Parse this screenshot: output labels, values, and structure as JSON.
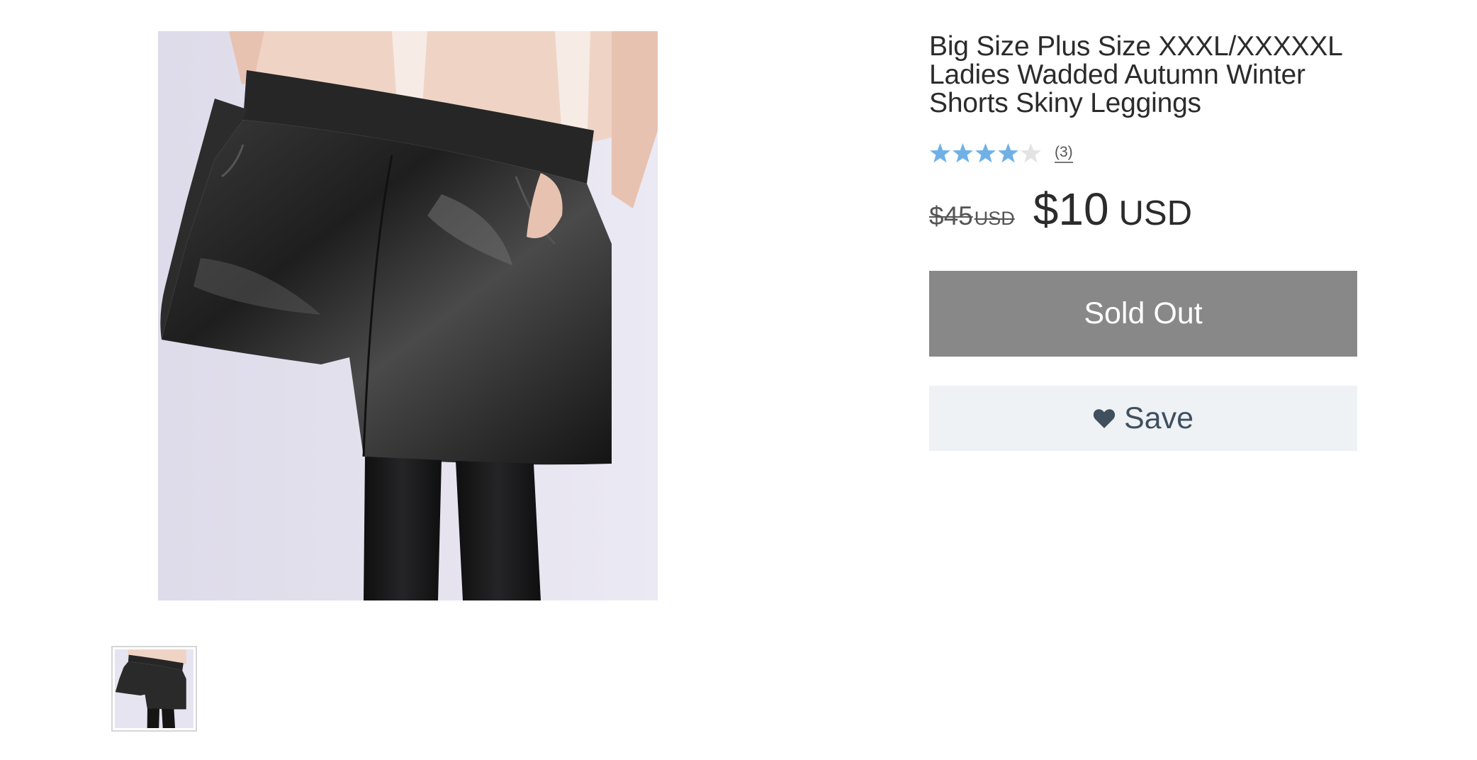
{
  "product": {
    "title": "Big Size Plus Size XXXL/XXXXXL Ladies Wadded Autumn Winter Shorts Skiny Leggings",
    "rating": {
      "value": 4,
      "max": 5,
      "review_count_label": "(3)"
    },
    "price": {
      "compare_at": "$45",
      "compare_at_currency": "USD",
      "current": "$10",
      "current_currency": "USD"
    },
    "buttons": {
      "sold_out_label": "Sold Out",
      "save_label": "Save"
    },
    "media": {
      "main_image_icon": "product-photo-leather-shorts",
      "thumbnail_count": 1
    }
  },
  "colors": {
    "star_filled": "#6fb1e6",
    "star_empty": "#e3e3e3",
    "sold_out_bg": "#888888",
    "save_bg": "#eef2f5",
    "save_text": "#3f4f5e"
  }
}
